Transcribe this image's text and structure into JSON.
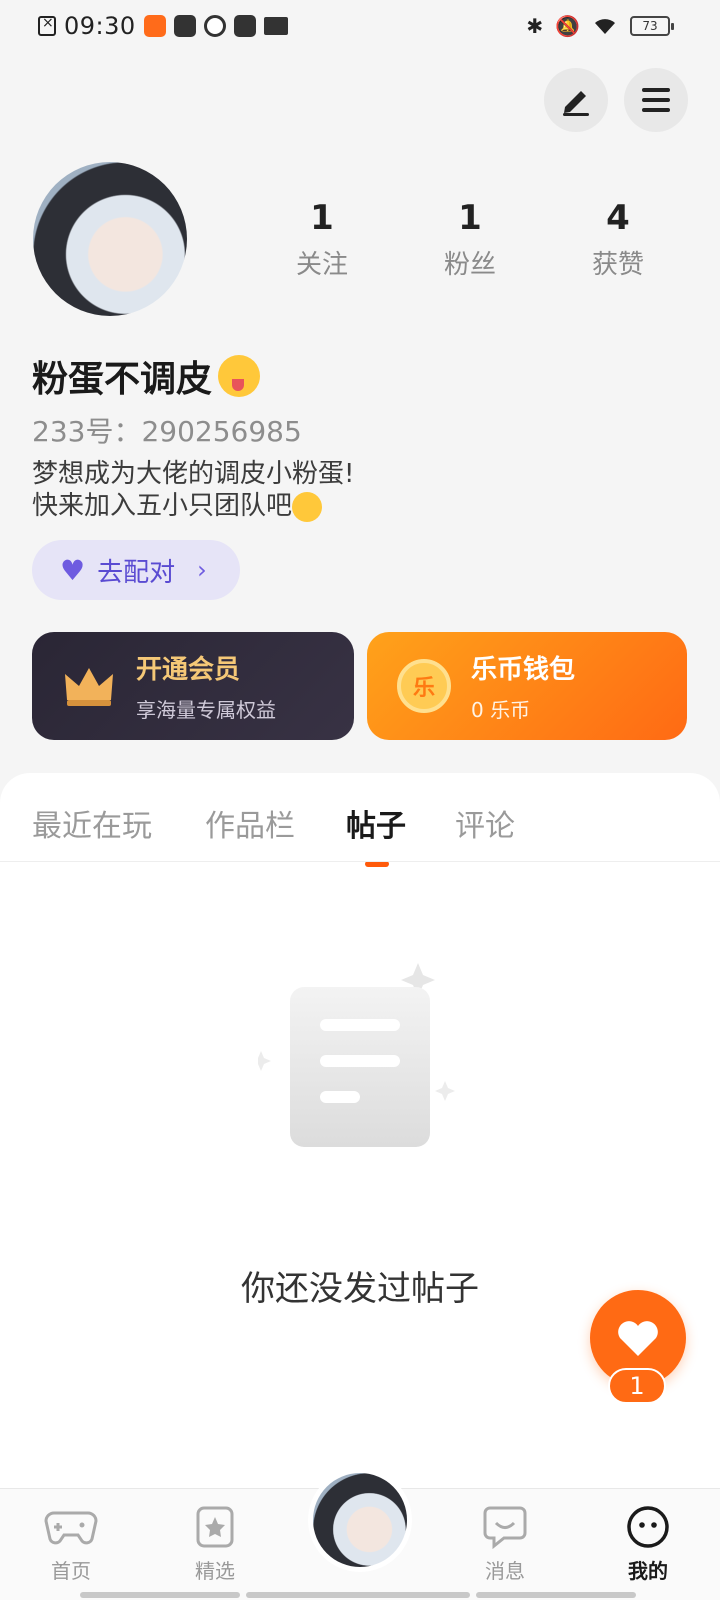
{
  "status_bar": {
    "time": "09:30",
    "battery": "73",
    "icons": [
      "sim-icon",
      "kuaishou-icon",
      "leaf-icon",
      "play-icon",
      "app-icon",
      "book-icon",
      "bluetooth-icon",
      "silent-bell-icon",
      "wifi-icon",
      "battery-icon"
    ]
  },
  "profile": {
    "nickname": "粉蛋不调皮",
    "id_line": "233号：290256985",
    "bio_line1": "梦想成为大佬的调皮小粉蛋!",
    "bio_line2": "快来加入五小只团队吧",
    "stats": [
      {
        "value": "1",
        "label": "关注"
      },
      {
        "value": "1",
        "label": "粉丝"
      },
      {
        "value": "4",
        "label": "获赞"
      }
    ],
    "pair_button": "去配对"
  },
  "cards": {
    "vip": {
      "title": "开通会员",
      "subtitle": "享海量专属权益"
    },
    "wallet": {
      "title": "乐币钱包",
      "subtitle": "0 乐币",
      "coin_glyph": "乐"
    }
  },
  "tabs": [
    {
      "label": "最近在玩",
      "active": false
    },
    {
      "label": "作品栏",
      "active": false
    },
    {
      "label": "帖子",
      "active": true
    },
    {
      "label": "评论",
      "active": false
    }
  ],
  "empty_state": {
    "text": "你还没发过帖子"
  },
  "fab": {
    "count": "1"
  },
  "bottom_nav": [
    {
      "label": "首页",
      "icon": "gamepad-icon",
      "active": false
    },
    {
      "label": "精选",
      "icon": "star-icon",
      "active": false
    },
    {
      "label": "消息",
      "icon": "chat-icon",
      "active": false
    },
    {
      "label": "我的",
      "icon": "face-icon",
      "active": true
    }
  ],
  "colors": {
    "accent": "#ff6a14",
    "pair": "#5a4bd2",
    "vip_gold": "#f5c877"
  }
}
